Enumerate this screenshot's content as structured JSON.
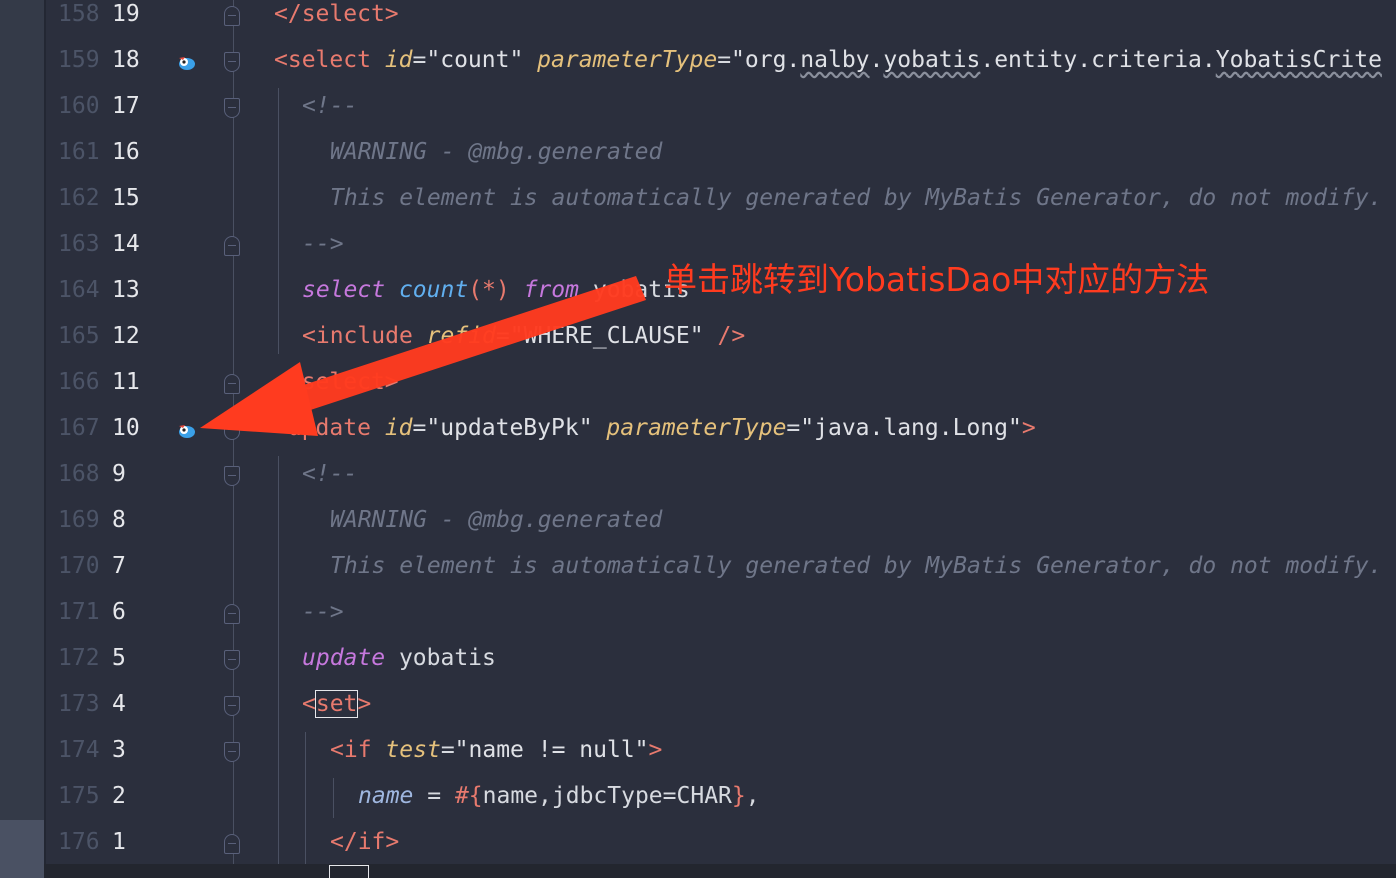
{
  "colors": {
    "background": "#2b2f3d",
    "annotation": "#ff3b1f",
    "tag": "#e87a6e",
    "attribute": "#e5c17c",
    "comment": "#6f7689",
    "keyword": "#c678dd"
  },
  "annotation": {
    "text": "单击跳转到YobatisDao中对应的方法",
    "icon": "arrow-pointing-left-to-mapper-icon"
  },
  "gutter_icon": "mybatis-bird-icon",
  "lines": [
    {
      "abs": "158",
      "rel": "19"
    },
    {
      "abs": "159",
      "rel": "18"
    },
    {
      "abs": "160",
      "rel": "17"
    },
    {
      "abs": "161",
      "rel": "16"
    },
    {
      "abs": "162",
      "rel": "15"
    },
    {
      "abs": "163",
      "rel": "14"
    },
    {
      "abs": "164",
      "rel": "13"
    },
    {
      "abs": "165",
      "rel": "12"
    },
    {
      "abs": "166",
      "rel": "11"
    },
    {
      "abs": "167",
      "rel": "10"
    },
    {
      "abs": "168",
      "rel": "9"
    },
    {
      "abs": "169",
      "rel": "8"
    },
    {
      "abs": "170",
      "rel": "7"
    },
    {
      "abs": "171",
      "rel": "6"
    },
    {
      "abs": "172",
      "rel": "5"
    },
    {
      "abs": "173",
      "rel": "4"
    },
    {
      "abs": "174",
      "rel": "3"
    },
    {
      "abs": "175",
      "rel": "2"
    },
    {
      "abs": "176",
      "rel": "1"
    }
  ],
  "code": {
    "l0": {
      "open": "</",
      "tag": "select",
      "close": ">"
    },
    "l1": {
      "open": "<",
      "tag": "select",
      "a1": "id",
      "v1": "\"count\"",
      "a2": "parameterType",
      "v2a": "\"org.",
      "v2b": "nalby",
      "v2c": ".",
      "v2d": "yobatis",
      "v2e": ".entity.criteria.",
      "v2f": "YobatisCrite"
    },
    "l2": {
      "text": "<!--"
    },
    "l3": {
      "text": "WARNING - @mbg.generated"
    },
    "l4": {
      "text": "This element is automatically generated by MyBatis Generator, do not modify."
    },
    "l5": {
      "text": "-->"
    },
    "l6": {
      "kw": "select",
      "fn": "count",
      "paren": "(*)",
      "kw2": "from",
      "rest": " yobatis"
    },
    "l7": {
      "open": "<",
      "tag": "include",
      "a1": "refid",
      "v1": "\"WHERE_CLAUSE\"",
      "close": " />"
    },
    "l8": {
      "open": "</",
      "tag": "select",
      "close": ">"
    },
    "l9": {
      "open": "<",
      "tag": "update",
      "a1": "id",
      "v1": "\"updateByPk\"",
      "a2": "parameterType",
      "v2": "\"java.lang.Long\"",
      "close": ">"
    },
    "l10": {
      "text": "<!--"
    },
    "l11": {
      "text": "WARNING - @mbg.generated"
    },
    "l12": {
      "text": "This element is automatically generated by MyBatis Generator, do not modify."
    },
    "l13": {
      "text": "-->"
    },
    "l14": {
      "kw": "update",
      "rest": " yobatis"
    },
    "l15": {
      "open": "<",
      "tag": "set",
      "close": ">"
    },
    "l16": {
      "open": "<",
      "tag": "if",
      "a1": "test",
      "v1": "\"name != null\"",
      "close": ">"
    },
    "l17": {
      "prop": "name",
      "eq": " = ",
      "hash": "#{",
      "inner": "name,jdbcType=CHAR",
      "end": "}",
      "comma": ","
    },
    "l18": {
      "open": "</",
      "tag": "if",
      "close": ">"
    }
  }
}
